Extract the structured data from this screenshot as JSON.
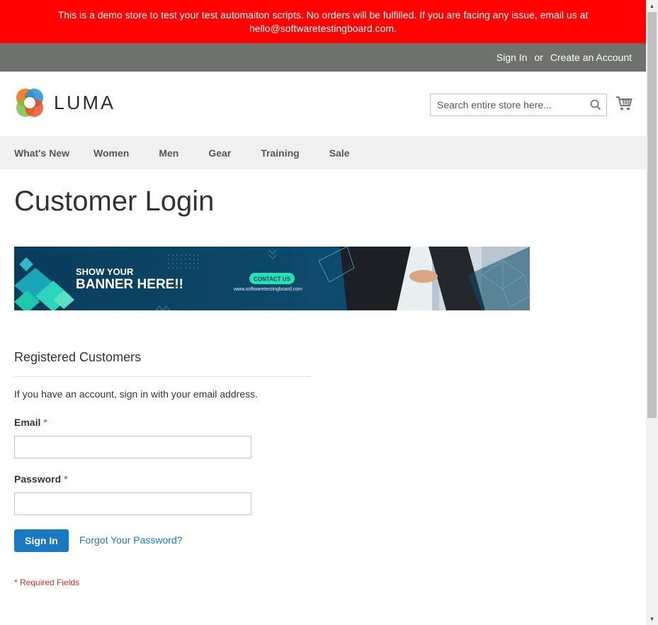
{
  "demo_notice": "This is a demo store to test your test automaiton scripts. No orders will be fulfilled. If you are facing any issue, email us at hello@softwaretestingboard.com.",
  "top_links": {
    "sign_in": "Sign In",
    "or": "or",
    "create_account": "Create an Account"
  },
  "logo": {
    "text": "LUMA"
  },
  "search": {
    "placeholder": "Search entire store here..."
  },
  "nav": {
    "items": [
      {
        "label": "What's New"
      },
      {
        "label": "Women"
      },
      {
        "label": "Men"
      },
      {
        "label": "Gear"
      },
      {
        "label": "Training"
      },
      {
        "label": "Sale"
      }
    ]
  },
  "page_title": "Customer Login",
  "banner": {
    "line1": "SHOW YOUR",
    "line2": "BANNER HERE!!",
    "cta": "CONTACT US",
    "url": "www.softwaretestingboard.com"
  },
  "login": {
    "section_title": "Registered Customers",
    "intro": "If you have an account, sign in with your email address.",
    "email_label": "Email",
    "password_label": "Password",
    "required_marker": "*",
    "email_value": "",
    "password_value": "",
    "sign_in_button": "Sign In",
    "forgot_link": "Forgot Your Password?",
    "required_note": "* Required Fields"
  },
  "colors": {
    "demo_bar": "#ff0101",
    "top_bar": "#6e716e",
    "nav_bar": "#f0f0f0",
    "primary_button": "#1979c3",
    "required": "#e02b27"
  }
}
